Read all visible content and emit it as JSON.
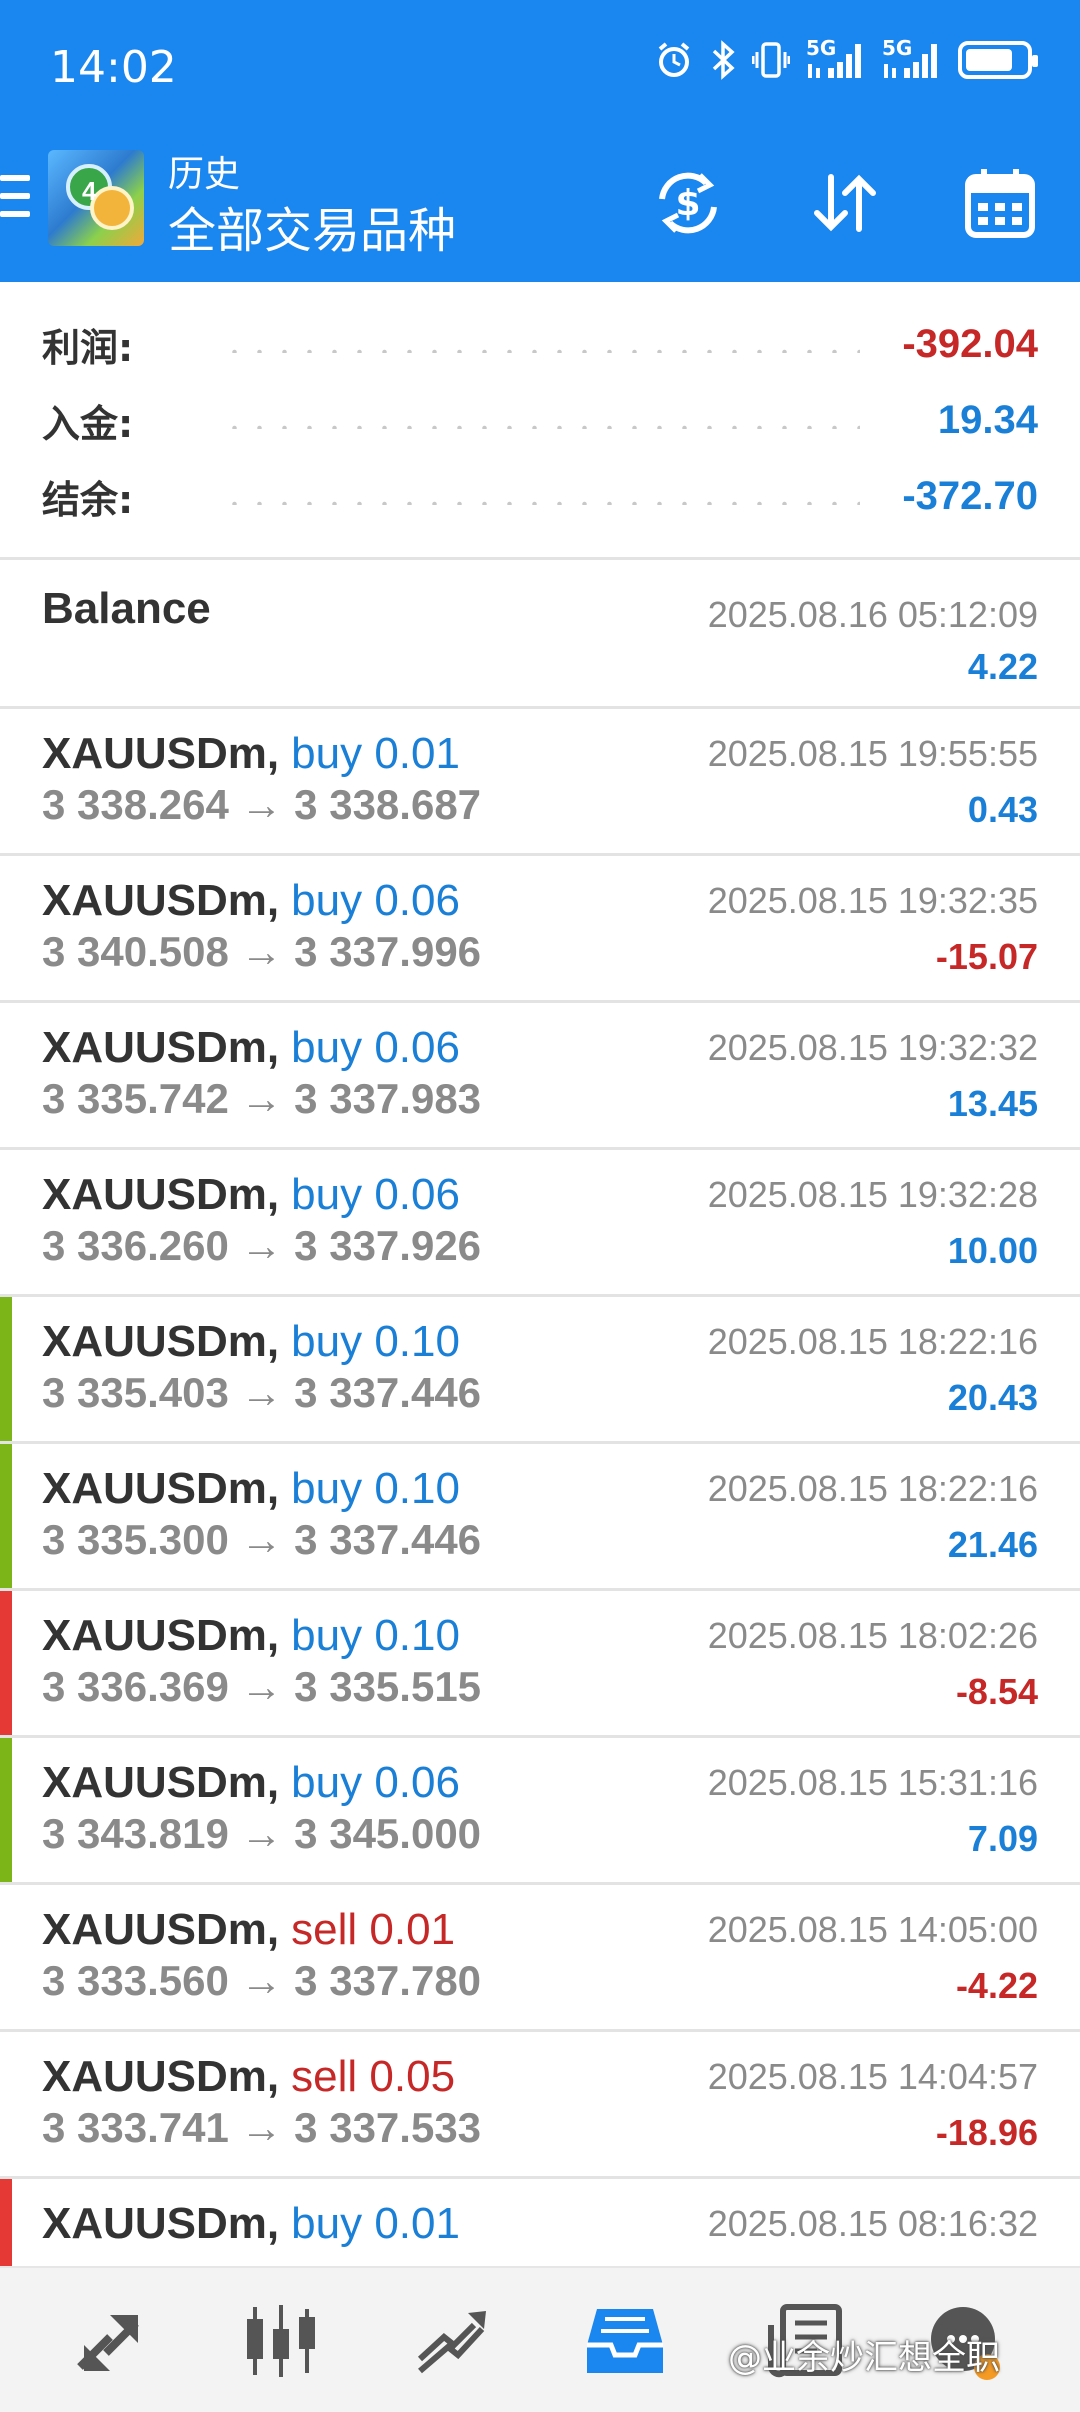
{
  "status_bar": {
    "time": "14:02",
    "icons": [
      "alarm-icon",
      "bluetooth-icon",
      "vibrate-icon",
      "signal-5g-icon",
      "signal-5g-icon",
      "battery-icon"
    ],
    "net1": "5G",
    "net2": "5G",
    "battery_level": 0.8
  },
  "app_bar": {
    "title": "历史",
    "subtitle": "全部交易品种",
    "actions": [
      "currency-icon",
      "sort-icon",
      "calendar-icon"
    ]
  },
  "summary": {
    "rows": [
      {
        "label": "利润:",
        "value": "-392.04",
        "color": "#c62828"
      },
      {
        "label": "入金:",
        "value": "19.34",
        "color": "#1a7fd6"
      },
      {
        "label": "结余:",
        "value": "-372.70",
        "color": "#1a7fd6"
      }
    ]
  },
  "balance_entry": {
    "label": "Balance",
    "datetime": "2025.08.16 05:12:09",
    "amount": "4.22"
  },
  "deals": [
    {
      "symbol": "XAUUSDm,",
      "side": "buy 0.01",
      "prices": "3 338.264 → 3 338.687",
      "datetime": "2025.08.15 19:55:55",
      "profit": "0.43",
      "side_color": "blue",
      "profit_color": "blue",
      "marker": ""
    },
    {
      "symbol": "XAUUSDm,",
      "side": "buy 0.06",
      "prices": "3 340.508 → 3 337.996",
      "datetime": "2025.08.15 19:32:35",
      "profit": "-15.07",
      "side_color": "blue",
      "profit_color": "red",
      "marker": ""
    },
    {
      "symbol": "XAUUSDm,",
      "side": "buy 0.06",
      "prices": "3 335.742 → 3 337.983",
      "datetime": "2025.08.15 19:32:32",
      "profit": "13.45",
      "side_color": "blue",
      "profit_color": "blue",
      "marker": ""
    },
    {
      "symbol": "XAUUSDm,",
      "side": "buy 0.06",
      "prices": "3 336.260 → 3 337.926",
      "datetime": "2025.08.15 19:32:28",
      "profit": "10.00",
      "side_color": "blue",
      "profit_color": "blue",
      "marker": ""
    },
    {
      "symbol": "XAUUSDm,",
      "side": "buy 0.10",
      "prices": "3 335.403 → 3 337.446",
      "datetime": "2025.08.15 18:22:16",
      "profit": "20.43",
      "side_color": "blue",
      "profit_color": "blue",
      "marker": "#7cb518"
    },
    {
      "symbol": "XAUUSDm,",
      "side": "buy 0.10",
      "prices": "3 335.300 → 3 337.446",
      "datetime": "2025.08.15 18:22:16",
      "profit": "21.46",
      "side_color": "blue",
      "profit_color": "blue",
      "marker": "#7cb518"
    },
    {
      "symbol": "XAUUSDm,",
      "side": "buy 0.10",
      "prices": "3 336.369 → 3 335.515",
      "datetime": "2025.08.15 18:02:26",
      "profit": "-8.54",
      "side_color": "blue",
      "profit_color": "red",
      "marker": "#e53935"
    },
    {
      "symbol": "XAUUSDm,",
      "side": "buy 0.06",
      "prices": "3 343.819 → 3 345.000",
      "datetime": "2025.08.15 15:31:16",
      "profit": "7.09",
      "side_color": "blue",
      "profit_color": "blue",
      "marker": "#7cb518"
    },
    {
      "symbol": "XAUUSDm,",
      "side": "sell 0.01",
      "prices": "3 333.560 → 3 337.780",
      "datetime": "2025.08.15 14:05:00",
      "profit": "-4.22",
      "side_color": "red",
      "profit_color": "red",
      "marker": ""
    },
    {
      "symbol": "XAUUSDm,",
      "side": "sell 0.05",
      "prices": "3 333.741 → 3 337.533",
      "datetime": "2025.08.15 14:04:57",
      "profit": "-18.96",
      "side_color": "red",
      "profit_color": "red",
      "marker": ""
    },
    {
      "symbol": "XAUUSDm,",
      "side": "buy 0.01",
      "prices": "",
      "datetime": "2025.08.15 08:16:32",
      "profit": "",
      "side_color": "blue",
      "profit_color": "blue",
      "marker": "#e53935"
    }
  ],
  "bottom_nav": {
    "items": [
      "quotes-icon",
      "chart-icon",
      "trade-icon",
      "history-icon",
      "news-icon",
      "chat-icon"
    ],
    "active": "history-icon"
  },
  "watermark": "@业余炒汇想全职"
}
